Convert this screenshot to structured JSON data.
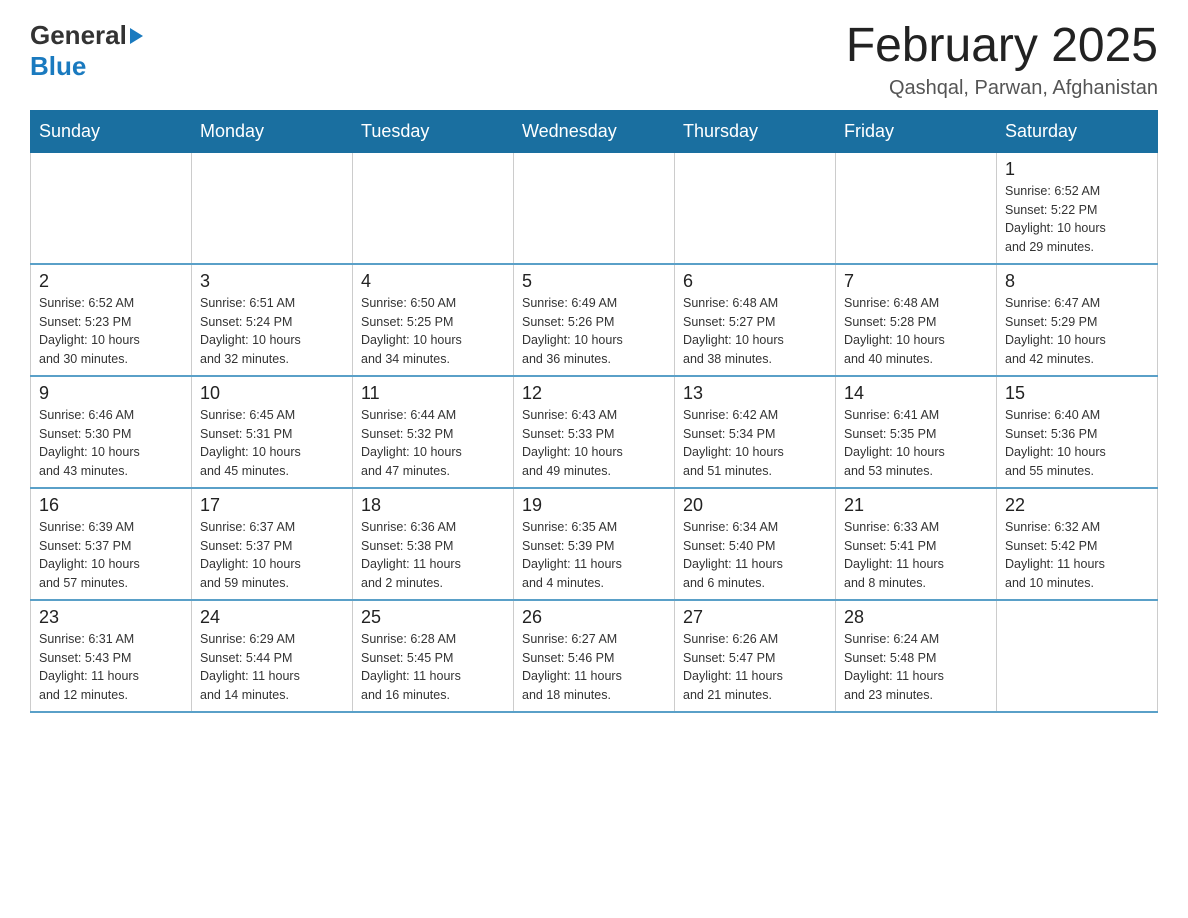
{
  "header": {
    "logo_general": "General",
    "logo_blue": "Blue",
    "title": "February 2025",
    "location": "Qashqal, Parwan, Afghanistan"
  },
  "weekdays": [
    "Sunday",
    "Monday",
    "Tuesday",
    "Wednesday",
    "Thursday",
    "Friday",
    "Saturday"
  ],
  "weeks": [
    [
      {
        "day": "",
        "info": ""
      },
      {
        "day": "",
        "info": ""
      },
      {
        "day": "",
        "info": ""
      },
      {
        "day": "",
        "info": ""
      },
      {
        "day": "",
        "info": ""
      },
      {
        "day": "",
        "info": ""
      },
      {
        "day": "1",
        "info": "Sunrise: 6:52 AM\nSunset: 5:22 PM\nDaylight: 10 hours\nand 29 minutes."
      }
    ],
    [
      {
        "day": "2",
        "info": "Sunrise: 6:52 AM\nSunset: 5:23 PM\nDaylight: 10 hours\nand 30 minutes."
      },
      {
        "day": "3",
        "info": "Sunrise: 6:51 AM\nSunset: 5:24 PM\nDaylight: 10 hours\nand 32 minutes."
      },
      {
        "day": "4",
        "info": "Sunrise: 6:50 AM\nSunset: 5:25 PM\nDaylight: 10 hours\nand 34 minutes."
      },
      {
        "day": "5",
        "info": "Sunrise: 6:49 AM\nSunset: 5:26 PM\nDaylight: 10 hours\nand 36 minutes."
      },
      {
        "day": "6",
        "info": "Sunrise: 6:48 AM\nSunset: 5:27 PM\nDaylight: 10 hours\nand 38 minutes."
      },
      {
        "day": "7",
        "info": "Sunrise: 6:48 AM\nSunset: 5:28 PM\nDaylight: 10 hours\nand 40 minutes."
      },
      {
        "day": "8",
        "info": "Sunrise: 6:47 AM\nSunset: 5:29 PM\nDaylight: 10 hours\nand 42 minutes."
      }
    ],
    [
      {
        "day": "9",
        "info": "Sunrise: 6:46 AM\nSunset: 5:30 PM\nDaylight: 10 hours\nand 43 minutes."
      },
      {
        "day": "10",
        "info": "Sunrise: 6:45 AM\nSunset: 5:31 PM\nDaylight: 10 hours\nand 45 minutes."
      },
      {
        "day": "11",
        "info": "Sunrise: 6:44 AM\nSunset: 5:32 PM\nDaylight: 10 hours\nand 47 minutes."
      },
      {
        "day": "12",
        "info": "Sunrise: 6:43 AM\nSunset: 5:33 PM\nDaylight: 10 hours\nand 49 minutes."
      },
      {
        "day": "13",
        "info": "Sunrise: 6:42 AM\nSunset: 5:34 PM\nDaylight: 10 hours\nand 51 minutes."
      },
      {
        "day": "14",
        "info": "Sunrise: 6:41 AM\nSunset: 5:35 PM\nDaylight: 10 hours\nand 53 minutes."
      },
      {
        "day": "15",
        "info": "Sunrise: 6:40 AM\nSunset: 5:36 PM\nDaylight: 10 hours\nand 55 minutes."
      }
    ],
    [
      {
        "day": "16",
        "info": "Sunrise: 6:39 AM\nSunset: 5:37 PM\nDaylight: 10 hours\nand 57 minutes."
      },
      {
        "day": "17",
        "info": "Sunrise: 6:37 AM\nSunset: 5:37 PM\nDaylight: 10 hours\nand 59 minutes."
      },
      {
        "day": "18",
        "info": "Sunrise: 6:36 AM\nSunset: 5:38 PM\nDaylight: 11 hours\nand 2 minutes."
      },
      {
        "day": "19",
        "info": "Sunrise: 6:35 AM\nSunset: 5:39 PM\nDaylight: 11 hours\nand 4 minutes."
      },
      {
        "day": "20",
        "info": "Sunrise: 6:34 AM\nSunset: 5:40 PM\nDaylight: 11 hours\nand 6 minutes."
      },
      {
        "day": "21",
        "info": "Sunrise: 6:33 AM\nSunset: 5:41 PM\nDaylight: 11 hours\nand 8 minutes."
      },
      {
        "day": "22",
        "info": "Sunrise: 6:32 AM\nSunset: 5:42 PM\nDaylight: 11 hours\nand 10 minutes."
      }
    ],
    [
      {
        "day": "23",
        "info": "Sunrise: 6:31 AM\nSunset: 5:43 PM\nDaylight: 11 hours\nand 12 minutes."
      },
      {
        "day": "24",
        "info": "Sunrise: 6:29 AM\nSunset: 5:44 PM\nDaylight: 11 hours\nand 14 minutes."
      },
      {
        "day": "25",
        "info": "Sunrise: 6:28 AM\nSunset: 5:45 PM\nDaylight: 11 hours\nand 16 minutes."
      },
      {
        "day": "26",
        "info": "Sunrise: 6:27 AM\nSunset: 5:46 PM\nDaylight: 11 hours\nand 18 minutes."
      },
      {
        "day": "27",
        "info": "Sunrise: 6:26 AM\nSunset: 5:47 PM\nDaylight: 11 hours\nand 21 minutes."
      },
      {
        "day": "28",
        "info": "Sunrise: 6:24 AM\nSunset: 5:48 PM\nDaylight: 11 hours\nand 23 minutes."
      },
      {
        "day": "",
        "info": ""
      }
    ]
  ]
}
